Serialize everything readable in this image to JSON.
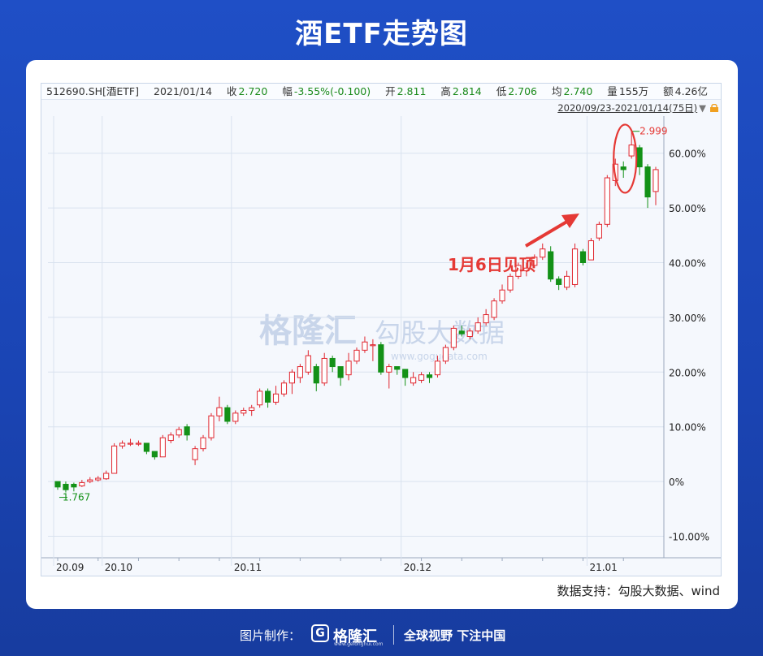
{
  "page": {
    "title": "酒ETF走势图"
  },
  "info": {
    "code": "512690.SH[酒ETF]",
    "date": "2021/01/14",
    "close_label": "收",
    "close": "2.720",
    "change_label": "幅",
    "change": "-3.55%(-0.100)",
    "open_label": "开",
    "open": "2.811",
    "high_label": "高",
    "high": "2.814",
    "low_label": "低",
    "low": "2.706",
    "avg_label": "均",
    "avg": "2.740",
    "volume_label": "量",
    "volume": "155万",
    "amount_label": "额",
    "amount": "4.26亿",
    "range": "2020/09/23-2021/01/14(75日)"
  },
  "annotation": {
    "peak_text": "1月6日见顶",
    "peak_price": "2.999",
    "low_price": "1.767"
  },
  "watermark": {
    "brand": "格隆汇",
    "brand2": "勾股大数据",
    "url": "www.gogudata.com"
  },
  "source": "数据支持：勾股大数据、wind",
  "footer": {
    "made_by": "图片制作：",
    "brand": "格隆汇",
    "brand_sub": "www.gelonghui.com",
    "logo": "G",
    "slogan": "全球视野 下注中国"
  },
  "colors": {
    "up": "#e0262f",
    "down": "#139117",
    "annotation": "#e53935"
  },
  "chart_data": {
    "type": "candlestick",
    "title": "酒ETF走势图",
    "ylabel": "",
    "ylim": [
      -10,
      65
    ],
    "y_ticks": [
      "60.00%",
      "50.00%",
      "40.00%",
      "30.00%",
      "20.00%",
      "10.00%",
      "0%",
      "-10.00%"
    ],
    "y_tick_values": [
      60,
      50,
      40,
      30,
      20,
      10,
      0,
      -10
    ],
    "x_ticks": [
      "20.09",
      "20.10",
      "20.11",
      "20.12",
      "21.01"
    ],
    "x_tick_index": [
      0,
      6,
      22,
      43,
      66
    ],
    "grid": true,
    "candles": [
      [
        0.0,
        -1.0,
        0.0,
        -1.5
      ],
      [
        -0.5,
        -1.5,
        0.0,
        -2.0
      ],
      [
        -0.5,
        -1.0,
        -0.2,
        -1.8
      ],
      [
        -0.8,
        -0.2,
        0.3,
        -1.0
      ],
      [
        0.0,
        0.3,
        0.8,
        -0.3
      ],
      [
        0.3,
        0.6,
        1.0,
        0.0
      ],
      [
        0.5,
        1.5,
        2.0,
        0.3
      ],
      [
        1.5,
        6.5,
        7.0,
        1.5
      ],
      [
        6.5,
        7.0,
        7.5,
        6.0
      ],
      [
        7.0,
        7.0,
        7.8,
        6.5
      ],
      [
        7.0,
        7.0,
        7.5,
        6.5
      ],
      [
        7.0,
        5.5,
        7.0,
        5.0
      ],
      [
        5.5,
        4.5,
        5.5,
        4.0
      ],
      [
        4.5,
        8.0,
        8.5,
        4.5
      ],
      [
        7.5,
        8.5,
        9.0,
        7.0
      ],
      [
        8.5,
        9.5,
        10.0,
        8.0
      ],
      [
        10.0,
        8.5,
        10.5,
        7.5
      ],
      [
        4.0,
        6.0,
        6.5,
        3.0
      ],
      [
        6.0,
        8.0,
        8.5,
        5.5
      ],
      [
        8.0,
        12.0,
        12.5,
        7.5
      ],
      [
        12.0,
        13.5,
        15.5,
        11.0
      ],
      [
        13.5,
        11.0,
        14.0,
        10.5
      ],
      [
        11.0,
        12.5,
        13.0,
        10.5
      ],
      [
        12.5,
        13.0,
        13.5,
        12.0
      ],
      [
        13.0,
        13.5,
        14.0,
        12.0
      ],
      [
        14.0,
        16.5,
        17.0,
        13.5
      ],
      [
        16.5,
        14.5,
        17.0,
        13.5
      ],
      [
        14.5,
        16.0,
        17.5,
        14.0
      ],
      [
        16.0,
        18.0,
        18.5,
        15.5
      ],
      [
        18.0,
        20.0,
        20.5,
        16.0
      ],
      [
        19.0,
        21.0,
        21.5,
        18.0
      ],
      [
        20.0,
        23.0,
        24.0,
        19.5
      ],
      [
        21.0,
        18.0,
        21.5,
        16.5
      ],
      [
        18.0,
        22.5,
        23.5,
        17.5
      ],
      [
        22.5,
        21.0,
        23.0,
        20.0
      ],
      [
        21.0,
        19.0,
        21.0,
        17.5
      ],
      [
        19.5,
        22.0,
        23.5,
        18.5
      ],
      [
        22.0,
        24.0,
        24.5,
        21.5
      ],
      [
        24.0,
        25.5,
        26.5,
        23.5
      ],
      [
        25.0,
        25.0,
        26.0,
        22.0
      ],
      [
        25.0,
        20.0,
        25.5,
        19.5
      ],
      [
        20.0,
        21.0,
        21.5,
        17.0
      ],
      [
        21.0,
        20.5,
        21.0,
        19.5
      ],
      [
        20.5,
        19.0,
        20.5,
        17.5
      ],
      [
        18.0,
        19.0,
        20.0,
        17.5
      ],
      [
        18.5,
        19.5,
        20.0,
        18.0
      ],
      [
        19.5,
        19.0,
        20.0,
        18.0
      ],
      [
        19.5,
        22.0,
        23.0,
        19.0
      ],
      [
        22.0,
        24.5,
        25.0,
        21.5
      ],
      [
        24.5,
        28.0,
        28.5,
        24.0
      ],
      [
        27.5,
        27.0,
        28.5,
        26.5
      ],
      [
        26.5,
        27.5,
        28.0,
        26.0
      ],
      [
        27.5,
        29.0,
        30.0,
        27.0
      ],
      [
        29.0,
        30.5,
        31.5,
        28.5
      ],
      [
        30.0,
        33.0,
        33.5,
        29.5
      ],
      [
        33.0,
        35.0,
        36.0,
        32.5
      ],
      [
        35.0,
        37.5,
        38.0,
        34.5
      ],
      [
        37.5,
        39.5,
        40.0,
        37.0
      ],
      [
        38.5,
        39.0,
        40.0,
        37.5
      ],
      [
        39.5,
        41.0,
        41.5,
        39.0
      ],
      [
        41.0,
        42.5,
        43.5,
        40.5
      ],
      [
        42.0,
        37.0,
        43.0,
        36.5
      ],
      [
        37.0,
        36.0,
        37.5,
        35.0
      ],
      [
        35.5,
        37.5,
        38.5,
        35.0
      ],
      [
        36.0,
        42.5,
        43.5,
        35.5
      ],
      [
        42.0,
        40.0,
        42.5,
        39.5
      ],
      [
        40.5,
        44.0,
        44.5,
        40.5
      ],
      [
        44.5,
        47.0,
        47.5,
        44.0
      ],
      [
        47.0,
        55.5,
        56.0,
        46.5
      ],
      [
        55.0,
        58.0,
        59.0,
        54.0
      ],
      [
        57.5,
        57.0,
        58.5,
        55.5
      ],
      [
        59.5,
        61.5,
        64.0,
        59.0
      ],
      [
        61.0,
        57.5,
        61.5,
        56.0
      ],
      [
        57.5,
        52.0,
        58.0,
        50.0
      ],
      [
        53.0,
        57.0,
        57.5,
        50.5
      ]
    ]
  }
}
